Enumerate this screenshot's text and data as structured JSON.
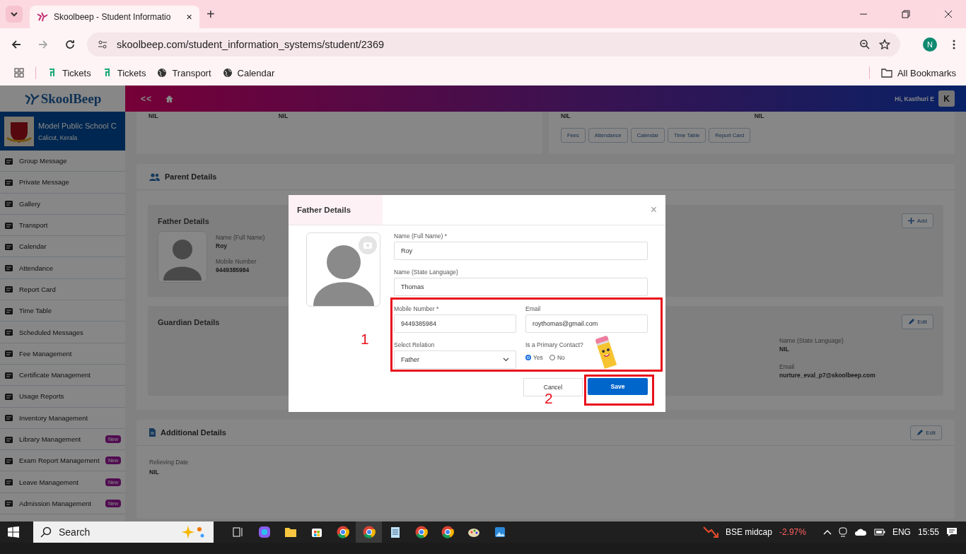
{
  "browser": {
    "tab_title": "Skoolbeep - Student Informatio",
    "tab_close": "✕",
    "new_tab": "+",
    "url": "skoolbeep.com/student_information_systems/student/2369",
    "profile_initial": "N",
    "all_bookmarks": "All Bookmarks",
    "bookmarks": [
      {
        "label": "Tickets",
        "kind": "ticket"
      },
      {
        "label": "Tickets",
        "kind": "ticket"
      },
      {
        "label": "Transport",
        "kind": "globe"
      },
      {
        "label": "Calendar",
        "kind": "globe"
      }
    ]
  },
  "header": {
    "collapse": "<<",
    "greeting": "Hi, Kasthuri E",
    "avatar_initial": "K"
  },
  "sidebar": {
    "logo": "SkoolBeep",
    "school_name": "Model Public School C",
    "school_location": "Calicut, Kerala",
    "items": [
      {
        "label": "Group Message"
      },
      {
        "label": "Private Message"
      },
      {
        "label": "Gallery"
      },
      {
        "label": "Transport"
      },
      {
        "label": "Calendar"
      },
      {
        "label": "Attendance"
      },
      {
        "label": "Report Card"
      },
      {
        "label": "Time Table"
      },
      {
        "label": "Scheduled Messages"
      },
      {
        "label": "Fee Management"
      },
      {
        "label": "Certificate Management"
      },
      {
        "label": "Usage Reports"
      },
      {
        "label": "Inventory Management"
      },
      {
        "label": "Library Management",
        "badge": "New"
      },
      {
        "label": "Exam Report Management",
        "badge": "New"
      },
      {
        "label": "Leave Management",
        "badge": "New"
      },
      {
        "label": "Admission Management",
        "badge": "New"
      }
    ]
  },
  "top_cards": {
    "left_values": [
      "NIL",
      "NIL"
    ],
    "right_values": [
      "NIL",
      "NIL"
    ],
    "buttons": [
      "Fees",
      "Attendance",
      "Calendar",
      "Time Table",
      "Report Card"
    ]
  },
  "parent_details": {
    "title": "Parent Details",
    "father": {
      "title": "Father Details",
      "action": "Add",
      "fields": [
        {
          "label": "Name (Full Name)",
          "value": "Roy"
        },
        {
          "label": "Mobile Number",
          "value": "9449385984"
        }
      ]
    },
    "guardian": {
      "title": "Guardian Details",
      "action": "Edit",
      "fields": [
        {
          "label": "Name (State Language)",
          "value": "NIL"
        },
        {
          "label": "Email",
          "value": "nurture_eval_p7@skoolbeep.com"
        }
      ]
    }
  },
  "additional_details": {
    "title": "Additional Details",
    "action": "Edit",
    "fields": [
      {
        "label": "Relieving Date",
        "value": "NIL"
      }
    ]
  },
  "modal": {
    "title": "Father Details",
    "close": "×",
    "full_name": {
      "label": "Name (Full Name) *",
      "value": "Roy"
    },
    "state_name": {
      "label": "Name (State Language)",
      "value": "Thomas"
    },
    "mobile": {
      "label": "Mobile Number *",
      "value": "9449385984"
    },
    "email": {
      "label": "Email",
      "value": "roythomas@gmail.com"
    },
    "relation": {
      "label": "Select Relation",
      "value": "Father"
    },
    "primary_contact": {
      "label": "Is a Primary Contact?",
      "options": [
        {
          "label": "Yes",
          "selected": true
        },
        {
          "label": "No",
          "selected": false
        }
      ]
    },
    "cancel": "Cancel",
    "save": "Save"
  },
  "annotations": [
    "1",
    "2"
  ],
  "taskbar": {
    "search": "Search",
    "ticker_name": "BSE midcap",
    "ticker_change": "-2.97%",
    "language": "ENG",
    "time": "15:55"
  }
}
